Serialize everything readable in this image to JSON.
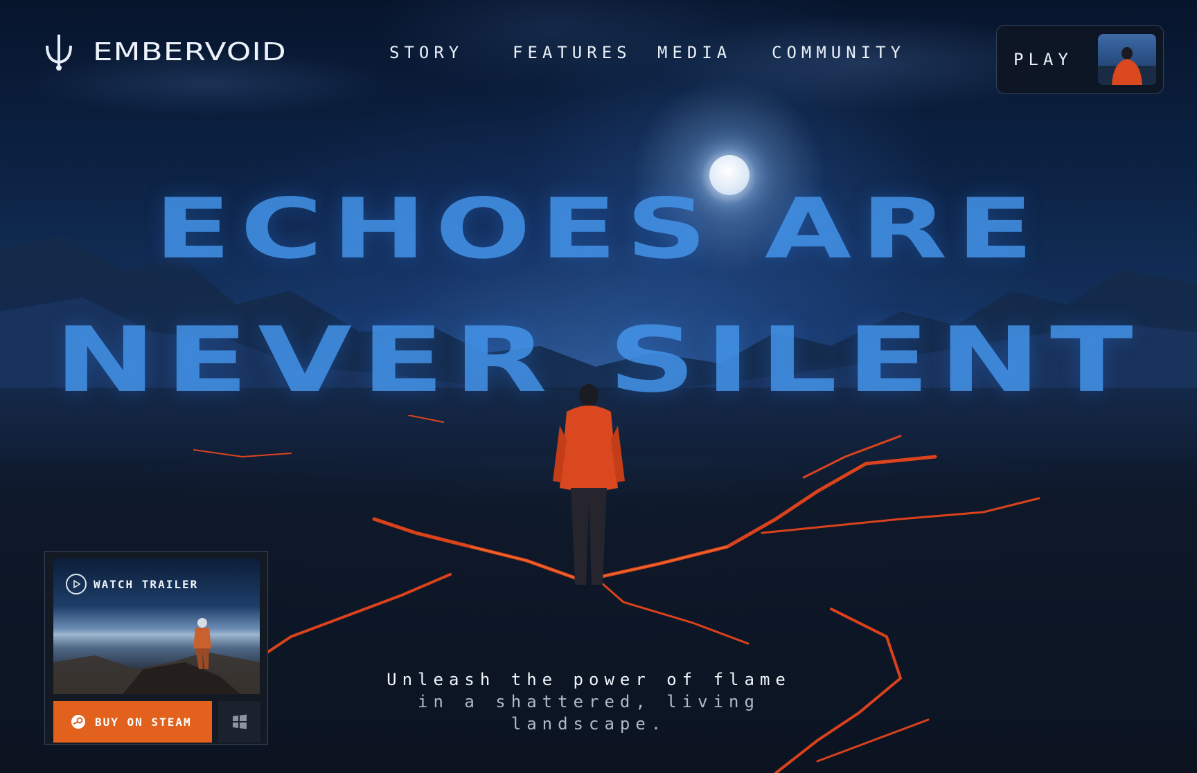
{
  "brand": {
    "name": "EMBERVOID",
    "logo_icon": "trident-icon"
  },
  "nav": {
    "items": [
      {
        "label": "STORY"
      },
      {
        "label": "FEATURES"
      },
      {
        "label": "MEDIA"
      },
      {
        "label": "COMMUNITY"
      }
    ]
  },
  "play_card": {
    "label": "PLAY"
  },
  "hero": {
    "headline_line1": "ECHOES ARE",
    "headline_line2": "NEVER SILENT",
    "tagline_line1": "Unleash the power of flame",
    "tagline_line2": "in a shattered, living",
    "tagline_line3": "landscape."
  },
  "trailer_card": {
    "watch_label": "WATCH TRAILER",
    "buy_label": "BUY ON STEAM",
    "platform_icon": "windows-icon"
  },
  "colors": {
    "accent": "#e2611c",
    "headline": "#4696eb",
    "lava": "#ff4a1a",
    "jacket": "#d9481e"
  }
}
